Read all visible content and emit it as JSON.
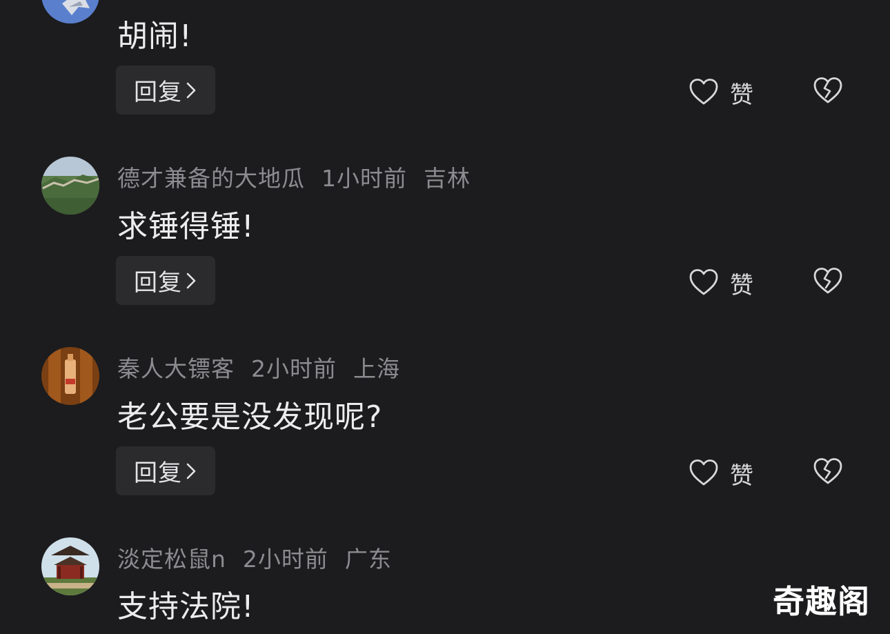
{
  "comments": [
    {
      "username": "",
      "time": "",
      "location": "",
      "text": "胡闹!",
      "reply_label": "回复",
      "like_label": "赞",
      "avatar": "fighter-jet-avatar"
    },
    {
      "username": "德才兼备的大地瓜",
      "time": "1小时前",
      "location": "吉林",
      "text": "求锤得锤!",
      "reply_label": "回复",
      "like_label": "赞",
      "avatar": "great-wall-avatar"
    },
    {
      "username": "秦人大镖客",
      "time": "2小时前",
      "location": "上海",
      "text": "老公要是没发现呢?",
      "reply_label": "回复",
      "like_label": "赞",
      "avatar": "bottle-avatar"
    },
    {
      "username": "淡定松鼠n",
      "time": "2小时前",
      "location": "广东",
      "text": "支持法院!",
      "reply_label": "",
      "like_label": "",
      "avatar": "pavilion-avatar"
    }
  ],
  "icons": {
    "like": "heart-outline-icon",
    "dislike": "broken-heart-icon",
    "chevron": "chevron-right-icon"
  },
  "colors": {
    "background": "#1c1c1e",
    "reply_button": "#2b2b2e",
    "meta_text": "#8c8c90",
    "comment_text": "#ececee"
  },
  "watermark": "奇趣阁"
}
